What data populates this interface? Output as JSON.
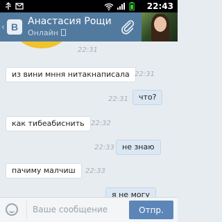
{
  "status_bar": {
    "time": "22:43",
    "icons": [
      "usb-icon",
      "notification-icon",
      "wifi-icon",
      "signal-icon",
      "battery-icon"
    ]
  },
  "header": {
    "name": "Анастасия Рощи",
    "status": "Онлайн",
    "logo": "B",
    "colors": {
      "header": "#527a9f",
      "outgoing": "#dbe7f3"
    }
  },
  "messages": [
    {
      "direction": "in",
      "text": "",
      "time": "22:31"
    },
    {
      "direction": "in",
      "text": "из вини мння нитакнаписала",
      "time": "22:31"
    },
    {
      "direction": "out",
      "text": "что?",
      "time": "22:31"
    },
    {
      "direction": "in",
      "text": "как тибеабиснить",
      "time": "22:32"
    },
    {
      "direction": "out",
      "text": "не знаю",
      "time": "22:33"
    },
    {
      "direction": "in",
      "text": "пачиму малчиш",
      "time": "22:33"
    },
    {
      "direction": "out",
      "text": "я не могу",
      "time": ""
    }
  ],
  "composer": {
    "placeholder": "Ваше сообщение",
    "send_label": "Отпр."
  }
}
